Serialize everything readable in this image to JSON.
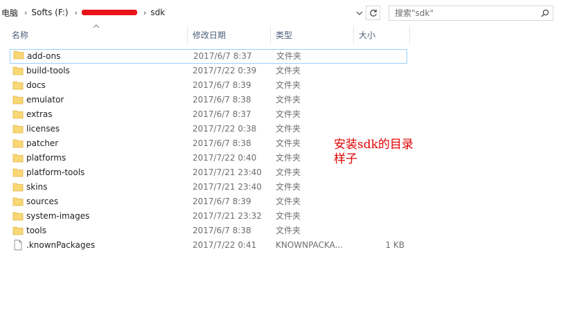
{
  "breadcrumb": {
    "items": [
      "电脑",
      "Softs (F:)",
      "sdk"
    ],
    "separator": "›"
  },
  "search": {
    "placeholder": "搜索\"sdk\""
  },
  "columns": {
    "name": "名称",
    "date": "修改日期",
    "type": "类型",
    "size": "大小"
  },
  "files": [
    {
      "name": "add-ons",
      "date": "2017/6/7 8:37",
      "type": "文件夹",
      "size": "",
      "icon": "folder-icon"
    },
    {
      "name": "build-tools",
      "date": "2017/7/22 0:39",
      "type": "文件夹",
      "size": "",
      "icon": "folder-icon"
    },
    {
      "name": "docs",
      "date": "2017/6/7 8:39",
      "type": "文件夹",
      "size": "",
      "icon": "folder-icon"
    },
    {
      "name": "emulator",
      "date": "2017/6/7 8:38",
      "type": "文件夹",
      "size": "",
      "icon": "folder-icon"
    },
    {
      "name": "extras",
      "date": "2017/6/7 8:37",
      "type": "文件夹",
      "size": "",
      "icon": "folder-icon"
    },
    {
      "name": "licenses",
      "date": "2017/7/22 0:38",
      "type": "文件夹",
      "size": "",
      "icon": "folder-icon"
    },
    {
      "name": "patcher",
      "date": "2017/6/7 8:38",
      "type": "文件夹",
      "size": "",
      "icon": "folder-icon"
    },
    {
      "name": "platforms",
      "date": "2017/7/22 0:40",
      "type": "文件夹",
      "size": "",
      "icon": "folder-icon"
    },
    {
      "name": "platform-tools",
      "date": "2017/7/21 23:40",
      "type": "文件夹",
      "size": "",
      "icon": "folder-icon"
    },
    {
      "name": "skins",
      "date": "2017/7/21 23:40",
      "type": "文件夹",
      "size": "",
      "icon": "folder-icon"
    },
    {
      "name": "sources",
      "date": "2017/6/7 8:39",
      "type": "文件夹",
      "size": "",
      "icon": "folder-icon"
    },
    {
      "name": "system-images",
      "date": "2017/7/21 23:32",
      "type": "文件夹",
      "size": "",
      "icon": "folder-icon"
    },
    {
      "name": "tools",
      "date": "2017/6/7 8:38",
      "type": "文件夹",
      "size": "",
      "icon": "folder-icon"
    },
    {
      "name": ".knownPackages",
      "date": "2017/7/22 0:41",
      "type": "KNOWNPACKA...",
      "size": "1 KB",
      "icon": "file-icon"
    }
  ],
  "annotation": "安装sdk的目录样子",
  "colors": {
    "folder": "#f8d775",
    "header_text": "#4c607a",
    "focus_border": "#99d1ff",
    "annotation": "#e00000",
    "redaction": "#e8141a"
  }
}
